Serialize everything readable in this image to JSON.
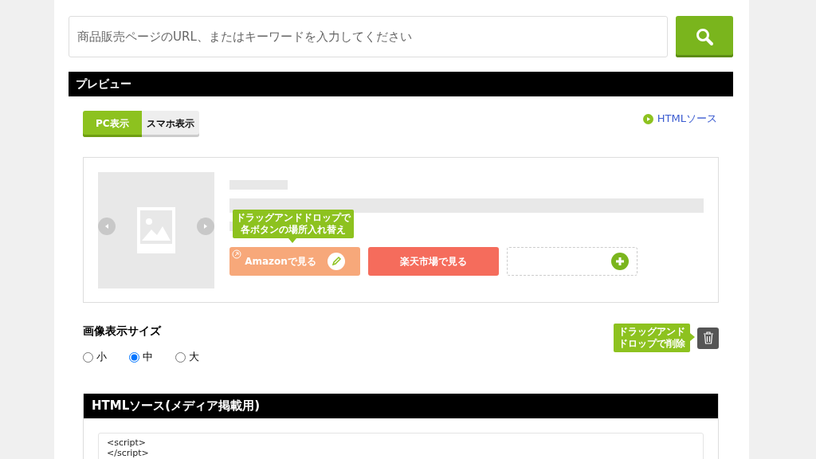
{
  "search": {
    "placeholder": "商品販売ページのURL、またはキーワードを入力してください"
  },
  "preview": {
    "title": "プレビュー",
    "tabs": [
      {
        "label": "PC表示",
        "selected": true
      },
      {
        "label": "スマホ表示",
        "selected": false
      }
    ],
    "html_link": "HTMLソース",
    "card": {
      "image": {
        "kind": "placeholder"
      },
      "tooltip": [
        "ドラッグアンドドロップで",
        "各ボタンの場所入れ替え"
      ],
      "buttons": [
        {
          "kind": "shop",
          "label": "Amazonで見る",
          "color": "#f7a87a",
          "editable": true
        },
        {
          "kind": "shop",
          "label": "楽天市場で見る",
          "color": "#f56c5c",
          "editable": false
        },
        {
          "kind": "add"
        }
      ]
    },
    "delete_tooltip": [
      "ドラッグアンド",
      "ドロップで削除"
    ],
    "size_label": "画像表示サイズ",
    "sizes": [
      {
        "label": "小",
        "selected": false
      },
      {
        "label": "中",
        "selected": true
      },
      {
        "label": "大",
        "selected": false
      }
    ]
  },
  "source": {
    "title": "HTMLソース(メディア掲載用)",
    "lines": [
      "<script>",
      "</script>"
    ]
  }
}
